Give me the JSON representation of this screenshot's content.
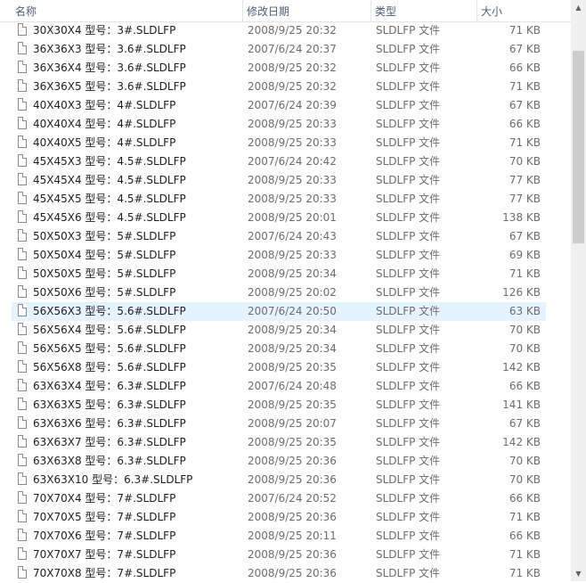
{
  "columns": {
    "name": "名称",
    "date": "修改日期",
    "type": "类型",
    "size": "大小"
  },
  "files": [
    {
      "name": "30X30X4 型号：3#.SLDLFP",
      "date": "2008/9/25 20:32",
      "type": "SLDLFP 文件",
      "size": "71 KB"
    },
    {
      "name": "36X36X3 型号：3.6#.SLDLFP",
      "date": "2007/6/24 20:37",
      "type": "SLDLFP 文件",
      "size": "67 KB"
    },
    {
      "name": "36X36X4 型号：3.6#.SLDLFP",
      "date": "2008/9/25 20:32",
      "type": "SLDLFP 文件",
      "size": "66 KB"
    },
    {
      "name": "36X36X5 型号：3.6#.SLDLFP",
      "date": "2008/9/25 20:32",
      "type": "SLDLFP 文件",
      "size": "71 KB"
    },
    {
      "name": "40X40X3 型号：4#.SLDLFP",
      "date": "2007/6/24 20:39",
      "type": "SLDLFP 文件",
      "size": "67 KB"
    },
    {
      "name": "40X40X4 型号：4#.SLDLFP",
      "date": "2008/9/25 20:33",
      "type": "SLDLFP 文件",
      "size": "66 KB"
    },
    {
      "name": "40X40X5 型号：4#.SLDLFP",
      "date": "2008/9/25 20:33",
      "type": "SLDLFP 文件",
      "size": "71 KB"
    },
    {
      "name": "45X45X3 型号：4.5#.SLDLFP",
      "date": "2007/6/24 20:42",
      "type": "SLDLFP 文件",
      "size": "70 KB"
    },
    {
      "name": "45X45X4 型号：4.5#.SLDLFP",
      "date": "2008/9/25 20:33",
      "type": "SLDLFP 文件",
      "size": "77 KB"
    },
    {
      "name": "45X45X5 型号：4.5#.SLDLFP",
      "date": "2008/9/25 20:33",
      "type": "SLDLFP 文件",
      "size": "77 KB"
    },
    {
      "name": "45X45X6 型号：4.5#.SLDLFP",
      "date": "2008/9/25 20:01",
      "type": "SLDLFP 文件",
      "size": "138 KB"
    },
    {
      "name": "50X50X3 型号：5#.SLDLFP",
      "date": "2007/6/24 20:43",
      "type": "SLDLFP 文件",
      "size": "67 KB"
    },
    {
      "name": "50X50X4 型号：5#.SLDLFP",
      "date": "2008/9/25 20:33",
      "type": "SLDLFP 文件",
      "size": "69 KB"
    },
    {
      "name": "50X50X5 型号：5#.SLDLFP",
      "date": "2008/9/25 20:34",
      "type": "SLDLFP 文件",
      "size": "71 KB"
    },
    {
      "name": "50X50X6 型号：5#.SLDLFP",
      "date": "2008/9/25 20:02",
      "type": "SLDLFP 文件",
      "size": "126 KB"
    },
    {
      "name": "56X56X3 型号：5.6#.SLDLFP",
      "date": "2007/6/24 20:50",
      "type": "SLDLFP 文件",
      "size": "63 KB",
      "selected": true
    },
    {
      "name": "56X56X4 型号：5.6#.SLDLFP",
      "date": "2008/9/25 20:34",
      "type": "SLDLFP 文件",
      "size": "70 KB"
    },
    {
      "name": "56X56X5 型号：5.6#.SLDLFP",
      "date": "2008/9/25 20:34",
      "type": "SLDLFP 文件",
      "size": "70 KB"
    },
    {
      "name": "56X56X8 型号：5.6#.SLDLFP",
      "date": "2008/9/25 20:35",
      "type": "SLDLFP 文件",
      "size": "142 KB"
    },
    {
      "name": "63X63X4 型号：6.3#.SLDLFP",
      "date": "2007/6/24 20:48",
      "type": "SLDLFP 文件",
      "size": "66 KB"
    },
    {
      "name": "63X63X5 型号：6.3#.SLDLFP",
      "date": "2008/9/25 20:35",
      "type": "SLDLFP 文件",
      "size": "141 KB"
    },
    {
      "name": "63X63X6 型号：6.3#.SLDLFP",
      "date": "2008/9/25 20:07",
      "type": "SLDLFP 文件",
      "size": "67 KB"
    },
    {
      "name": "63X63X7 型号：6.3#.SLDLFP",
      "date": "2008/9/25 20:35",
      "type": "SLDLFP 文件",
      "size": "142 KB"
    },
    {
      "name": "63X63X8 型号：6.3#.SLDLFP",
      "date": "2008/9/25 20:36",
      "type": "SLDLFP 文件",
      "size": "70 KB"
    },
    {
      "name": "63X63X10 型号：6.3#.SLDLFP",
      "date": "2008/9/25 20:36",
      "type": "SLDLFP 文件",
      "size": "70 KB"
    },
    {
      "name": "70X70X4 型号：7#.SLDLFP",
      "date": "2007/6/24 20:52",
      "type": "SLDLFP 文件",
      "size": "66 KB"
    },
    {
      "name": "70X70X5 型号：7#.SLDLFP",
      "date": "2008/9/25 20:36",
      "type": "SLDLFP 文件",
      "size": "71 KB"
    },
    {
      "name": "70X70X6 型号：7#.SLDLFP",
      "date": "2008/9/25 20:11",
      "type": "SLDLFP 文件",
      "size": "66 KB"
    },
    {
      "name": "70X70X7 型号：7#.SLDLFP",
      "date": "2008/9/25 20:36",
      "type": "SLDLFP 文件",
      "size": "71 KB"
    },
    {
      "name": "70X70X8 型号：7#.SLDLFP",
      "date": "2008/9/25 20:36",
      "type": "SLDLFP 文件",
      "size": "71 KB"
    }
  ]
}
